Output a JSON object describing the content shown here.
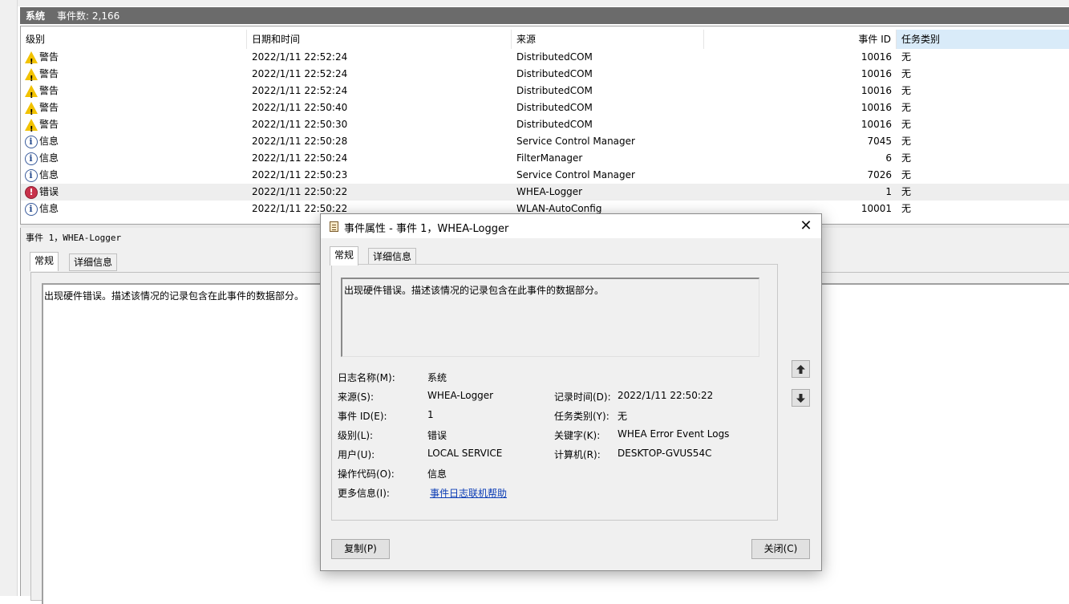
{
  "header": {
    "title": "系统",
    "event_count": "事件数: 2,166"
  },
  "columns": {
    "level": "级别",
    "datetime": "日期和时间",
    "source": "来源",
    "event_id": "事件 ID",
    "task_category": "任务类别"
  },
  "rows": [
    {
      "icon": "warning-icon",
      "level": "警告",
      "datetime": "2022/1/11 22:52:24",
      "source": "DistributedCOM",
      "event_id": "10016",
      "task_category": "无"
    },
    {
      "icon": "warning-icon",
      "level": "警告",
      "datetime": "2022/1/11 22:52:24",
      "source": "DistributedCOM",
      "event_id": "10016",
      "task_category": "无"
    },
    {
      "icon": "warning-icon",
      "level": "警告",
      "datetime": "2022/1/11 22:52:24",
      "source": "DistributedCOM",
      "event_id": "10016",
      "task_category": "无"
    },
    {
      "icon": "warning-icon",
      "level": "警告",
      "datetime": "2022/1/11 22:50:40",
      "source": "DistributedCOM",
      "event_id": "10016",
      "task_category": "无"
    },
    {
      "icon": "warning-icon",
      "level": "警告",
      "datetime": "2022/1/11 22:50:30",
      "source": "DistributedCOM",
      "event_id": "10016",
      "task_category": "无"
    },
    {
      "icon": "info-icon",
      "level": "信息",
      "datetime": "2022/1/11 22:50:28",
      "source": "Service Control Manager",
      "event_id": "7045",
      "task_category": "无"
    },
    {
      "icon": "info-icon",
      "level": "信息",
      "datetime": "2022/1/11 22:50:24",
      "source": "FilterManager",
      "event_id": "6",
      "task_category": "无"
    },
    {
      "icon": "info-icon",
      "level": "信息",
      "datetime": "2022/1/11 22:50:23",
      "source": "Service Control Manager",
      "event_id": "7026",
      "task_category": "无"
    },
    {
      "icon": "error-icon",
      "level": "错误",
      "datetime": "2022/1/11 22:50:22",
      "source": "WHEA-Logger",
      "event_id": "1",
      "task_category": "无",
      "selected": true
    },
    {
      "icon": "info-icon",
      "level": "信息",
      "datetime": "2022/1/11 22:50:22",
      "source": "WLAN-AutoConfig",
      "event_id": "10001",
      "task_category": "无"
    }
  ],
  "detail_pane": {
    "title": "事件 1，WHEA-Logger",
    "tab_general": "常规",
    "tab_details": "详细信息",
    "description": "出现硬件错误。描述该情况的记录包含在此事件的数据部分。"
  },
  "dialog": {
    "title": "事件属性 - 事件 1，WHEA-Logger",
    "tab_general": "常规",
    "tab_details": "详细信息",
    "description": "出现硬件错误。描述该情况的记录包含在此事件的数据部分。",
    "fields": {
      "log_name_label": "日志名称(M):",
      "log_name_value": "系统",
      "source_label": "来源(S):",
      "source_value": "WHEA-Logger",
      "event_id_label": "事件 ID(E):",
      "event_id_value": "1",
      "level_label": "级别(L):",
      "level_value": "错误",
      "user_label": "用户(U):",
      "user_value": "LOCAL SERVICE",
      "opcode_label": "操作代码(O):",
      "opcode_value": "信息",
      "more_info_label": "更多信息(I):",
      "more_info_link": "事件日志联机帮助",
      "logged_label": "记录时间(D):",
      "logged_value": "2022/1/11 22:50:22",
      "task_category_label": "任务类别(Y):",
      "task_category_value": "无",
      "keywords_label": "关键字(K):",
      "keywords_value": "WHEA Error Event Logs",
      "computer_label": "计算机(R):",
      "computer_value": "DESKTOP-GVUS54C"
    },
    "copy_button": "复制(P)",
    "close_button": "关闭(C)"
  }
}
